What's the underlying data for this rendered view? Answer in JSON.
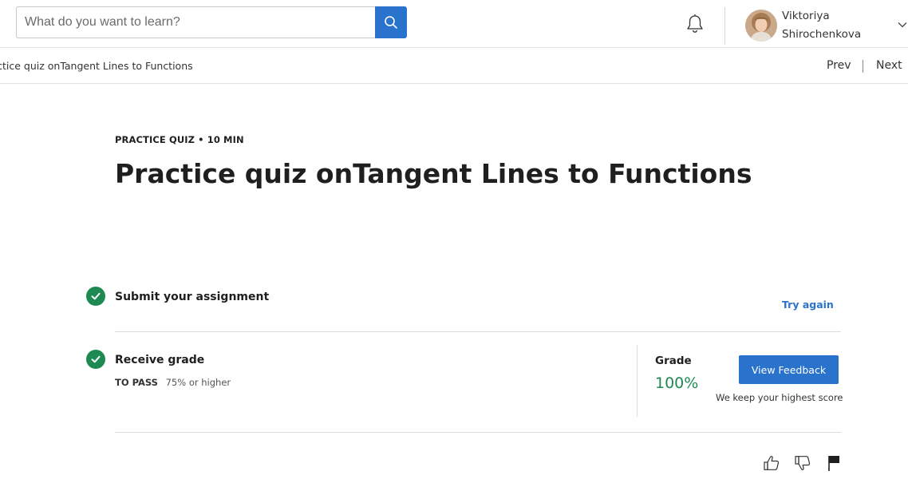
{
  "header": {
    "search": {
      "placeholder": "What do you want to learn?",
      "value": ""
    },
    "icons": {
      "search": "search-icon",
      "notifications": "bell-icon",
      "menu": "chevron-down-icon"
    },
    "user": {
      "name": "Viktoriya Shirochenkova"
    }
  },
  "subnav": {
    "breadcrumb": "Practice quiz onTangent Lines to Functions",
    "prev_label": "Prev",
    "next_label": "Next"
  },
  "quiz": {
    "eyebrow": "PRACTICE QUIZ • 10 MIN",
    "title": "Practice quiz onTangent Lines to Functions",
    "steps": [
      {
        "title": "Submit your assignment",
        "action_label": "Try again",
        "status": "check-circle-icon"
      },
      {
        "title": "Receive grade",
        "pass_label": "TO PASS",
        "pass_value": "75% or higher",
        "status": "check-circle-icon"
      }
    ],
    "grade": {
      "label": "Grade",
      "value": "100%",
      "button_label": "View Feedback",
      "note": "We keep your highest score"
    }
  },
  "footer_actions": {
    "icons": [
      "thumbs-up-icon",
      "thumbs-down-icon",
      "flag-icon"
    ]
  },
  "colors": {
    "accent": "#2a73cc",
    "success": "#1d8a52",
    "divider": "#dcdcdc",
    "text": "#1f1f1f"
  }
}
